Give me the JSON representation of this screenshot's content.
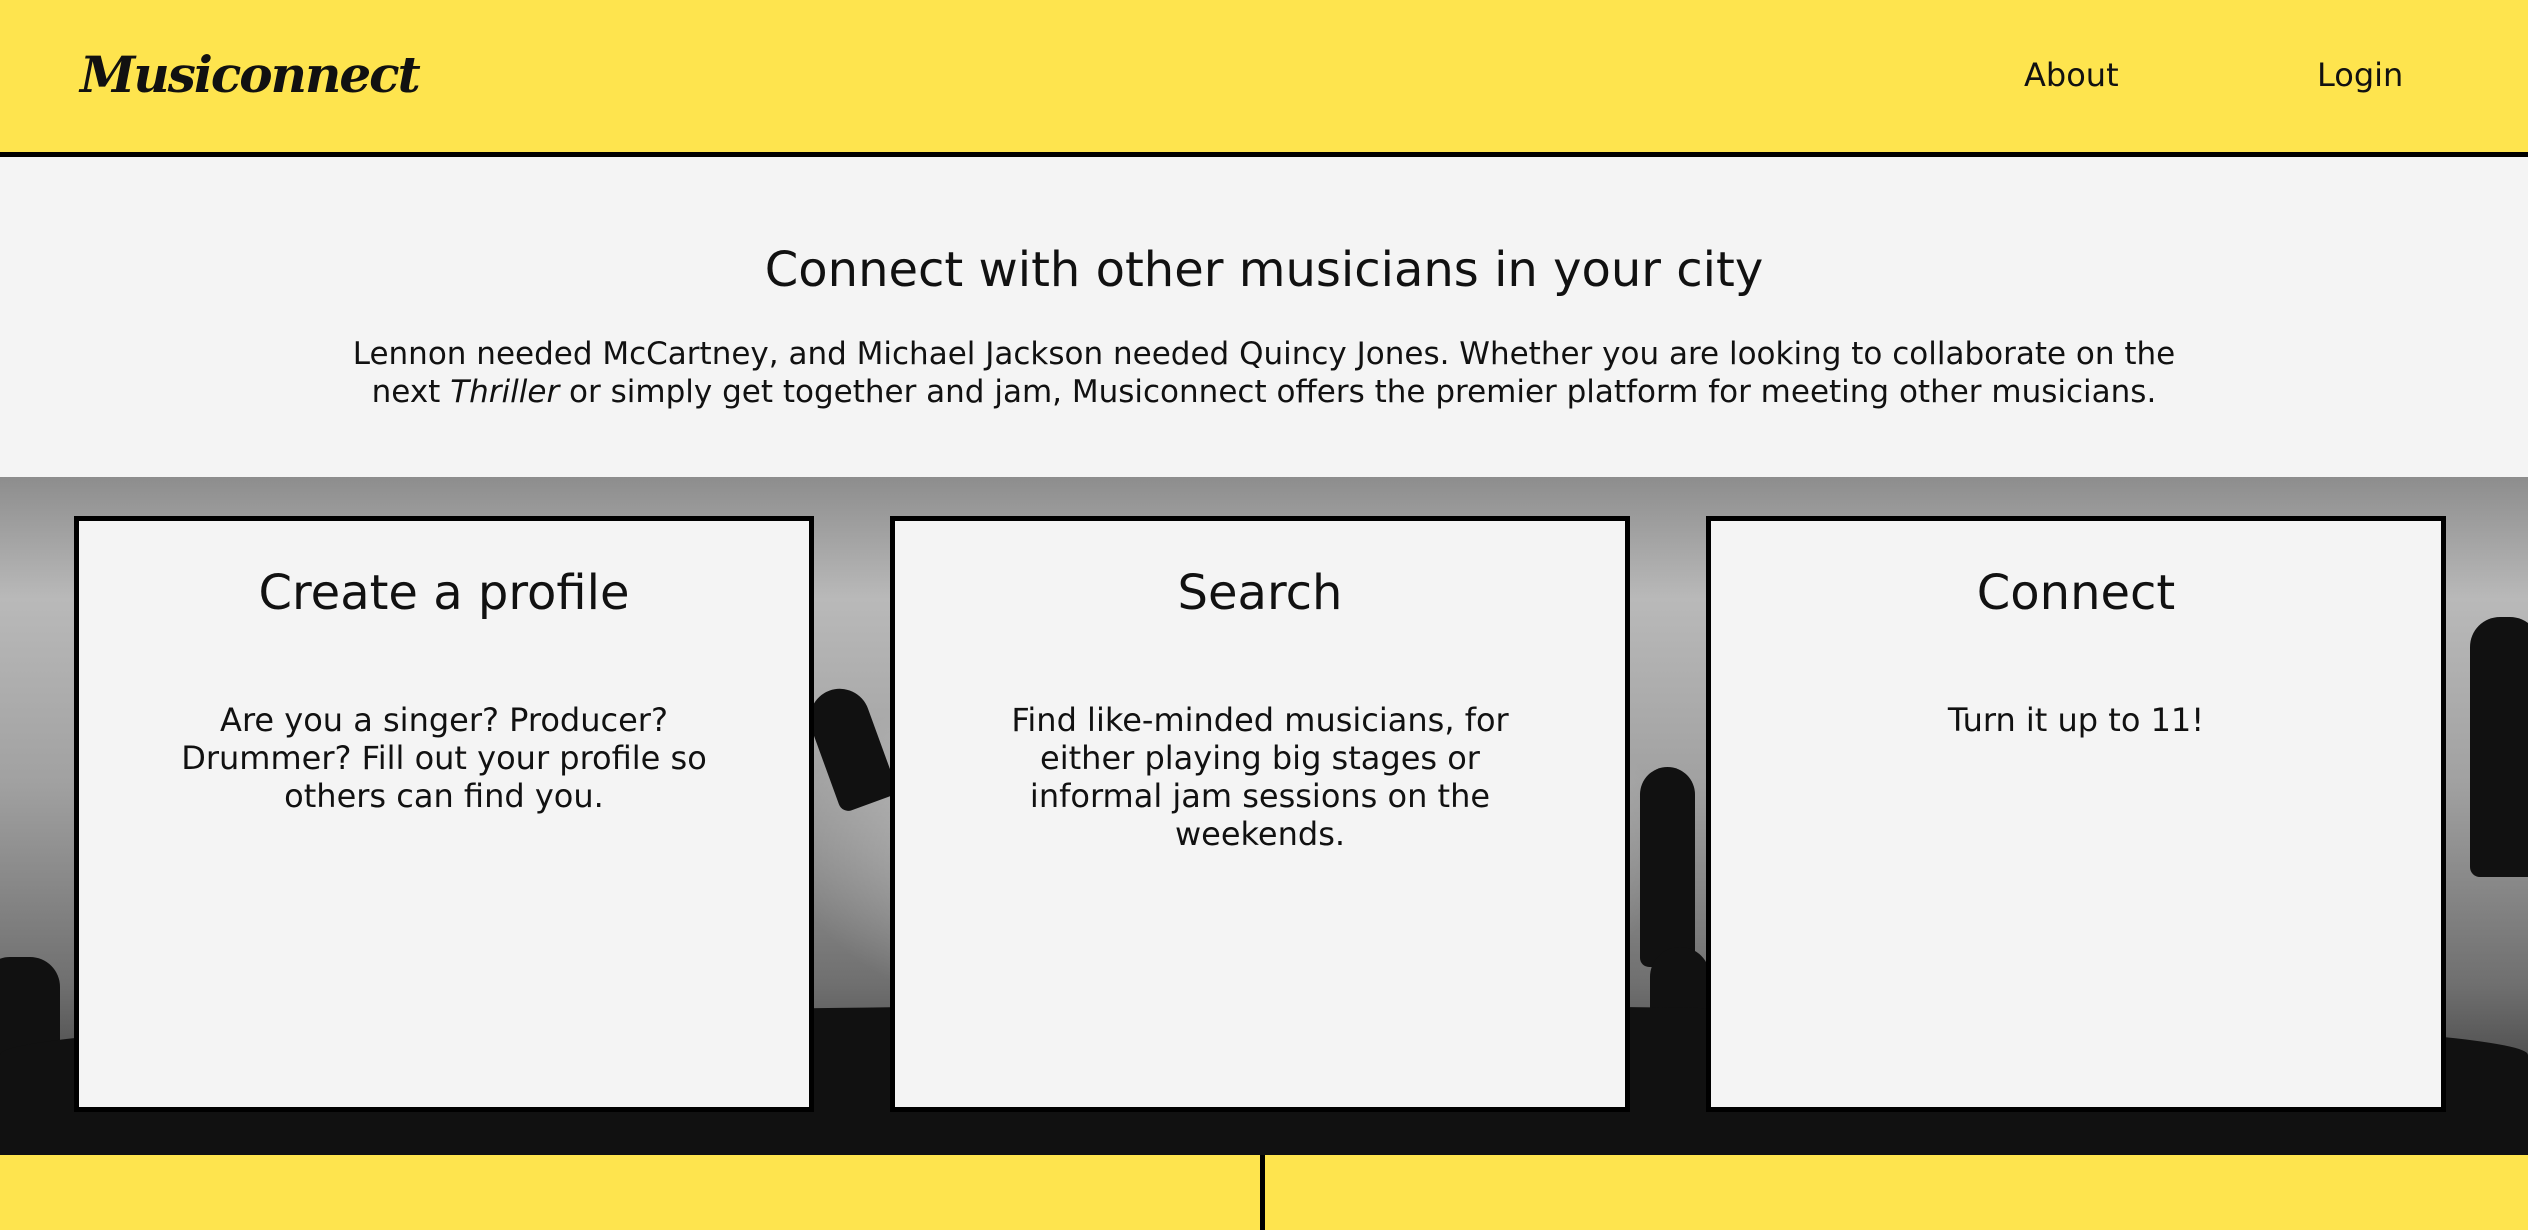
{
  "header": {
    "logo": "Musiconnect",
    "nav": {
      "about": "About",
      "login": "Login"
    }
  },
  "intro": {
    "title": "Connect with other musicians in your city",
    "line1": "Lennon needed McCartney, and Michael Jackson needed Quincy Jones. Whether you are looking to collaborate on the",
    "line2_prefix": "next",
    "line2_emphasis": "Thriller",
    "line2_suffix": "or simply get together and jam, Musiconnect offers the premier platform for meeting other musicians."
  },
  "cards": [
    {
      "title": "Create a profile",
      "text": "Are you a singer? Producer? Drummer? Fill out your profile so others can find you."
    },
    {
      "title": "Search",
      "text": "Find like-minded musicians, for either playing big stages or informal jam sessions on the weekends."
    },
    {
      "title": "Connect",
      "text": "Turn it up to 11!"
    }
  ],
  "colors": {
    "brand_yellow": "#fee44e",
    "panel": "#f4f4f4",
    "border": "#000000"
  }
}
